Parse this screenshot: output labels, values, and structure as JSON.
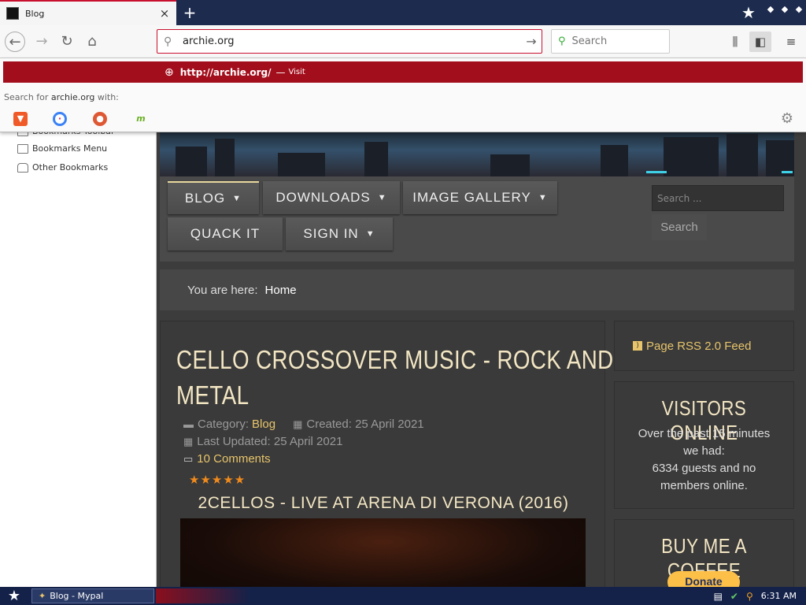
{
  "browser": {
    "tab": {
      "title": "Blog",
      "close": "×"
    },
    "new_tab": "+",
    "address": {
      "value": "archie.org"
    },
    "search": {
      "placeholder": "Search"
    },
    "popup": {
      "url": "http://archie.org/",
      "dash": "—",
      "visit": "Visit",
      "search_prefix": "Search for",
      "search_term": "archie.org",
      "search_suffix": "with:",
      "engines": [
        "brave",
        "qwant",
        "duckduckgo",
        "mojeek"
      ]
    }
  },
  "sidebar": {
    "items": [
      {
        "label": "Bookmarks Toolbar"
      },
      {
        "label": "Bookmarks Menu"
      },
      {
        "label": "Other Bookmarks"
      }
    ]
  },
  "site": {
    "menu": [
      {
        "label": "BLOG",
        "caret": "▼"
      },
      {
        "label": "DOWNLOADS",
        "caret": "▼"
      },
      {
        "label": "IMAGE GALLERY",
        "caret": "▼"
      },
      {
        "label": "QUACK IT"
      },
      {
        "label": "SIGN IN",
        "caret": "▼"
      }
    ],
    "search": {
      "placeholder": "Search ...",
      "button": "Search"
    },
    "breadcrumb": {
      "label": "You are here:",
      "current": "Home"
    },
    "article": {
      "title_line1": "CELLO CROSSOVER MUSIC - ROCK AND",
      "title_line2": "METAL",
      "category_label": "Category:",
      "category": "Blog",
      "created": "Created: 25 April 2021",
      "updated": "Last Updated: 25 April 2021",
      "comments": "10 Comments",
      "rating": 5,
      "rating_stars": "★★★★★",
      "video_title": "2CELLOS - LIVE AT ARENA DI VERONA (2016)"
    },
    "rss": {
      "label": "Page RSS 2.0 Feed"
    },
    "visitors": {
      "title": "VISITORS ONLINE",
      "line1": "Over the past 15 minutes",
      "line2": "we had:",
      "line3": "6334 guests and no",
      "line4": "members online."
    },
    "coffee": {
      "title": "BUY ME A COFFEE",
      "donate": "Donate"
    }
  },
  "taskbar": {
    "task": "Blog - Mypal",
    "clock": "6:31 AM"
  },
  "colors": {
    "accent_red": "#a30e1c",
    "taskbar": "#14224a",
    "site_gold": "#e8c56b",
    "site_cream": "#f3e6c3",
    "rating_orange": "#f08a1c"
  }
}
